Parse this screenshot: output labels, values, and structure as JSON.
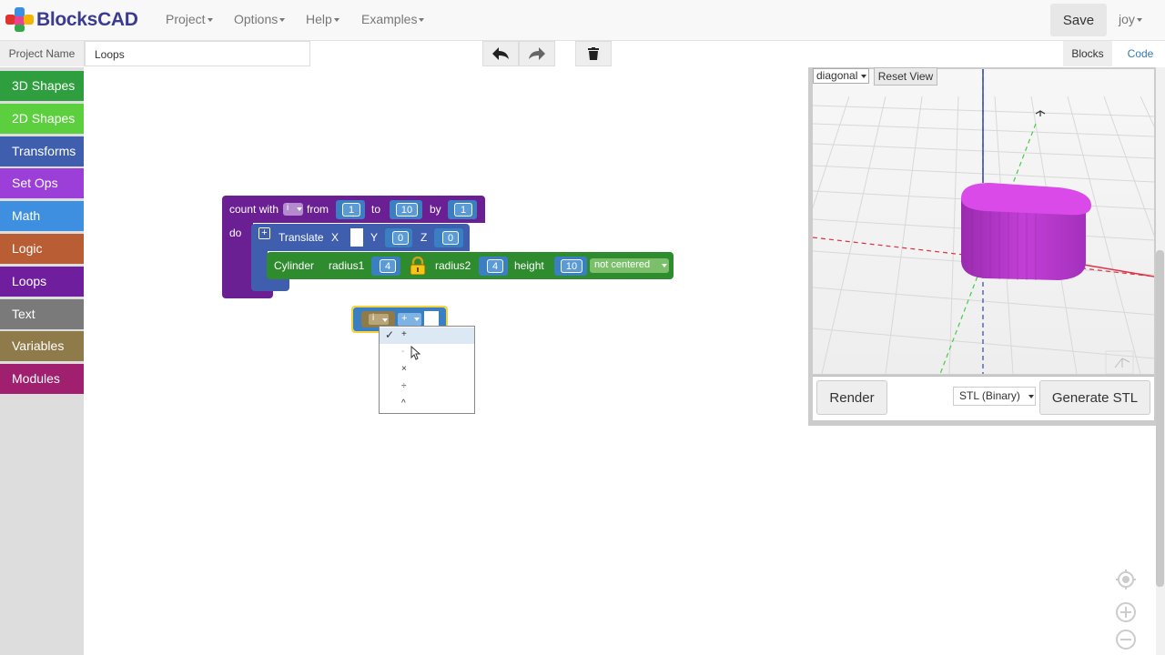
{
  "app": {
    "logo_text": "BlocksCAD",
    "menu": [
      "Project",
      "Options",
      "Help",
      "Examples"
    ],
    "save_label": "Save",
    "user": "joy"
  },
  "project": {
    "name_label": "Project Name",
    "name_value": "Loops",
    "tab_blocks": "Blocks",
    "tab_code": "Code"
  },
  "categories": [
    {
      "label": "3D Shapes",
      "color": "#2e9e3e"
    },
    {
      "label": "2D Shapes",
      "color": "#5ccf3f"
    },
    {
      "label": "Transforms",
      "color": "#3f5fae"
    },
    {
      "label": "Set Ops",
      "color": "#9c3fd8"
    },
    {
      "label": "Math",
      "color": "#3f8fe0"
    },
    {
      "label": "Logic",
      "color": "#b85d34"
    },
    {
      "label": "Loops",
      "color": "#6f1f9e"
    },
    {
      "label": "Text",
      "color": "#7a7a7a"
    },
    {
      "label": "Variables",
      "color": "#8f7a4a"
    },
    {
      "label": "Modules",
      "color": "#a01f6e"
    }
  ],
  "blocks": {
    "loop": {
      "count_with": "count with",
      "var": "i",
      "from": "from",
      "from_val": "1",
      "to": "to",
      "to_val": "10",
      "by": "by",
      "by_val": "1",
      "do": "do"
    },
    "translate": {
      "label": "Translate",
      "x": "X",
      "y": "Y",
      "y_val": "0",
      "z": "Z",
      "z_val": "0"
    },
    "cylinder": {
      "label": "Cylinder",
      "radius1": "radius1",
      "radius1_val": "4",
      "radius2": "radius2",
      "radius2_val": "4",
      "height": "height",
      "height_val": "10",
      "centered": "not centered"
    },
    "arith": {
      "var": "i",
      "op": "+"
    }
  },
  "dropdown": {
    "options": [
      "+",
      "-",
      "×",
      "÷",
      "^"
    ],
    "selected_index": 0,
    "check": "✓"
  },
  "viewer": {
    "view_mode": "diagonal",
    "reset_label": "Reset View",
    "render_label": "Render",
    "format": "STL (Binary)",
    "generate_label": "Generate STL"
  },
  "colors": {
    "loop_block": "#6a1f92",
    "translate_block": "#3f5fae",
    "cylinder_block": "#2e8b2e",
    "math_block": "#3a7fc2",
    "shape_3d": "#cc44dd"
  }
}
